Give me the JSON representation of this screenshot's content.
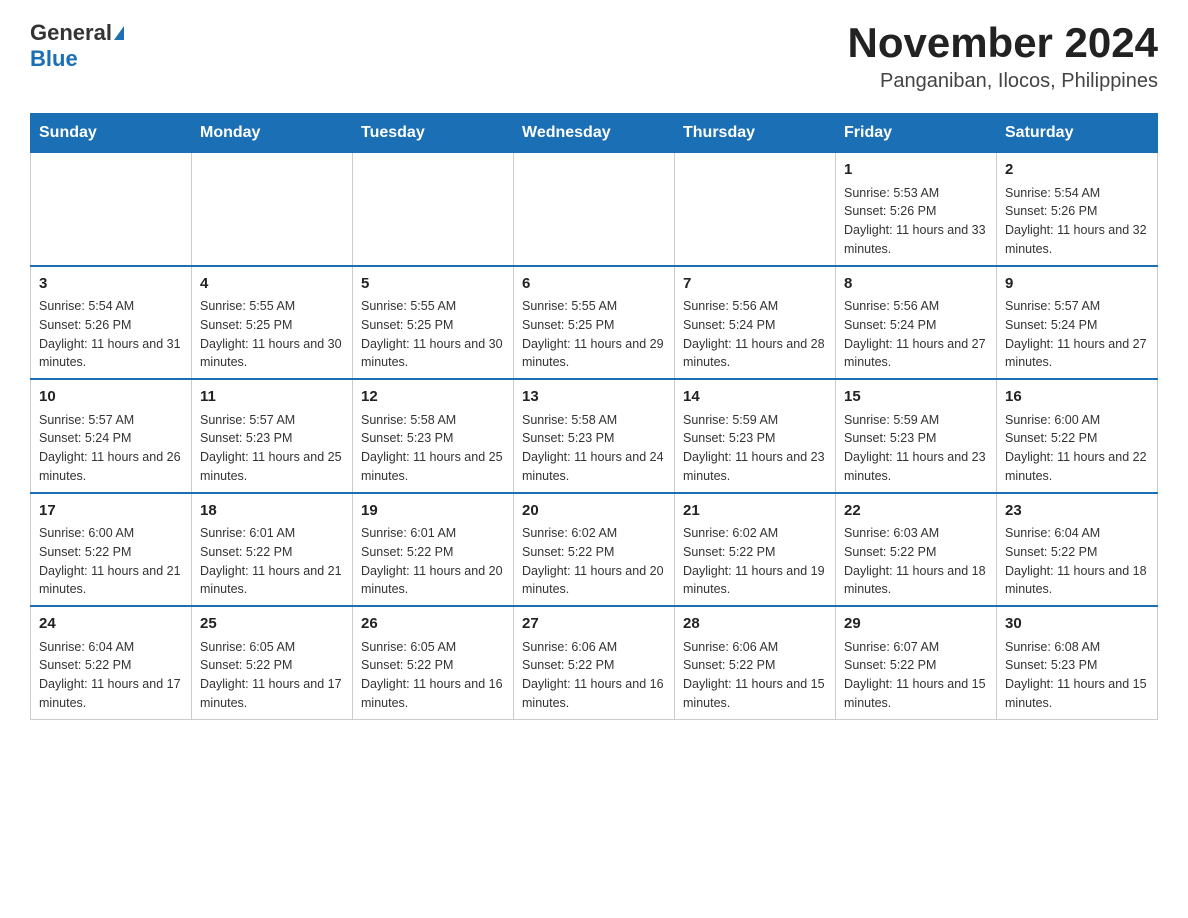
{
  "header": {
    "logo_general": "General",
    "logo_blue": "Blue",
    "title": "November 2024",
    "subtitle": "Panganiban, Ilocos, Philippines"
  },
  "calendar": {
    "days_of_week": [
      "Sunday",
      "Monday",
      "Tuesday",
      "Wednesday",
      "Thursday",
      "Friday",
      "Saturday"
    ],
    "weeks": [
      [
        {
          "day": "",
          "info": ""
        },
        {
          "day": "",
          "info": ""
        },
        {
          "day": "",
          "info": ""
        },
        {
          "day": "",
          "info": ""
        },
        {
          "day": "",
          "info": ""
        },
        {
          "day": "1",
          "info": "Sunrise: 5:53 AM\nSunset: 5:26 PM\nDaylight: 11 hours and 33 minutes."
        },
        {
          "day": "2",
          "info": "Sunrise: 5:54 AM\nSunset: 5:26 PM\nDaylight: 11 hours and 32 minutes."
        }
      ],
      [
        {
          "day": "3",
          "info": "Sunrise: 5:54 AM\nSunset: 5:26 PM\nDaylight: 11 hours and 31 minutes."
        },
        {
          "day": "4",
          "info": "Sunrise: 5:55 AM\nSunset: 5:25 PM\nDaylight: 11 hours and 30 minutes."
        },
        {
          "day": "5",
          "info": "Sunrise: 5:55 AM\nSunset: 5:25 PM\nDaylight: 11 hours and 30 minutes."
        },
        {
          "day": "6",
          "info": "Sunrise: 5:55 AM\nSunset: 5:25 PM\nDaylight: 11 hours and 29 minutes."
        },
        {
          "day": "7",
          "info": "Sunrise: 5:56 AM\nSunset: 5:24 PM\nDaylight: 11 hours and 28 minutes."
        },
        {
          "day": "8",
          "info": "Sunrise: 5:56 AM\nSunset: 5:24 PM\nDaylight: 11 hours and 27 minutes."
        },
        {
          "day": "9",
          "info": "Sunrise: 5:57 AM\nSunset: 5:24 PM\nDaylight: 11 hours and 27 minutes."
        }
      ],
      [
        {
          "day": "10",
          "info": "Sunrise: 5:57 AM\nSunset: 5:24 PM\nDaylight: 11 hours and 26 minutes."
        },
        {
          "day": "11",
          "info": "Sunrise: 5:57 AM\nSunset: 5:23 PM\nDaylight: 11 hours and 25 minutes."
        },
        {
          "day": "12",
          "info": "Sunrise: 5:58 AM\nSunset: 5:23 PM\nDaylight: 11 hours and 25 minutes."
        },
        {
          "day": "13",
          "info": "Sunrise: 5:58 AM\nSunset: 5:23 PM\nDaylight: 11 hours and 24 minutes."
        },
        {
          "day": "14",
          "info": "Sunrise: 5:59 AM\nSunset: 5:23 PM\nDaylight: 11 hours and 23 minutes."
        },
        {
          "day": "15",
          "info": "Sunrise: 5:59 AM\nSunset: 5:23 PM\nDaylight: 11 hours and 23 minutes."
        },
        {
          "day": "16",
          "info": "Sunrise: 6:00 AM\nSunset: 5:22 PM\nDaylight: 11 hours and 22 minutes."
        }
      ],
      [
        {
          "day": "17",
          "info": "Sunrise: 6:00 AM\nSunset: 5:22 PM\nDaylight: 11 hours and 21 minutes."
        },
        {
          "day": "18",
          "info": "Sunrise: 6:01 AM\nSunset: 5:22 PM\nDaylight: 11 hours and 21 minutes."
        },
        {
          "day": "19",
          "info": "Sunrise: 6:01 AM\nSunset: 5:22 PM\nDaylight: 11 hours and 20 minutes."
        },
        {
          "day": "20",
          "info": "Sunrise: 6:02 AM\nSunset: 5:22 PM\nDaylight: 11 hours and 20 minutes."
        },
        {
          "day": "21",
          "info": "Sunrise: 6:02 AM\nSunset: 5:22 PM\nDaylight: 11 hours and 19 minutes."
        },
        {
          "day": "22",
          "info": "Sunrise: 6:03 AM\nSunset: 5:22 PM\nDaylight: 11 hours and 18 minutes."
        },
        {
          "day": "23",
          "info": "Sunrise: 6:04 AM\nSunset: 5:22 PM\nDaylight: 11 hours and 18 minutes."
        }
      ],
      [
        {
          "day": "24",
          "info": "Sunrise: 6:04 AM\nSunset: 5:22 PM\nDaylight: 11 hours and 17 minutes."
        },
        {
          "day": "25",
          "info": "Sunrise: 6:05 AM\nSunset: 5:22 PM\nDaylight: 11 hours and 17 minutes."
        },
        {
          "day": "26",
          "info": "Sunrise: 6:05 AM\nSunset: 5:22 PM\nDaylight: 11 hours and 16 minutes."
        },
        {
          "day": "27",
          "info": "Sunrise: 6:06 AM\nSunset: 5:22 PM\nDaylight: 11 hours and 16 minutes."
        },
        {
          "day": "28",
          "info": "Sunrise: 6:06 AM\nSunset: 5:22 PM\nDaylight: 11 hours and 15 minutes."
        },
        {
          "day": "29",
          "info": "Sunrise: 6:07 AM\nSunset: 5:22 PM\nDaylight: 11 hours and 15 minutes."
        },
        {
          "day": "30",
          "info": "Sunrise: 6:08 AM\nSunset: 5:23 PM\nDaylight: 11 hours and 15 minutes."
        }
      ]
    ]
  }
}
